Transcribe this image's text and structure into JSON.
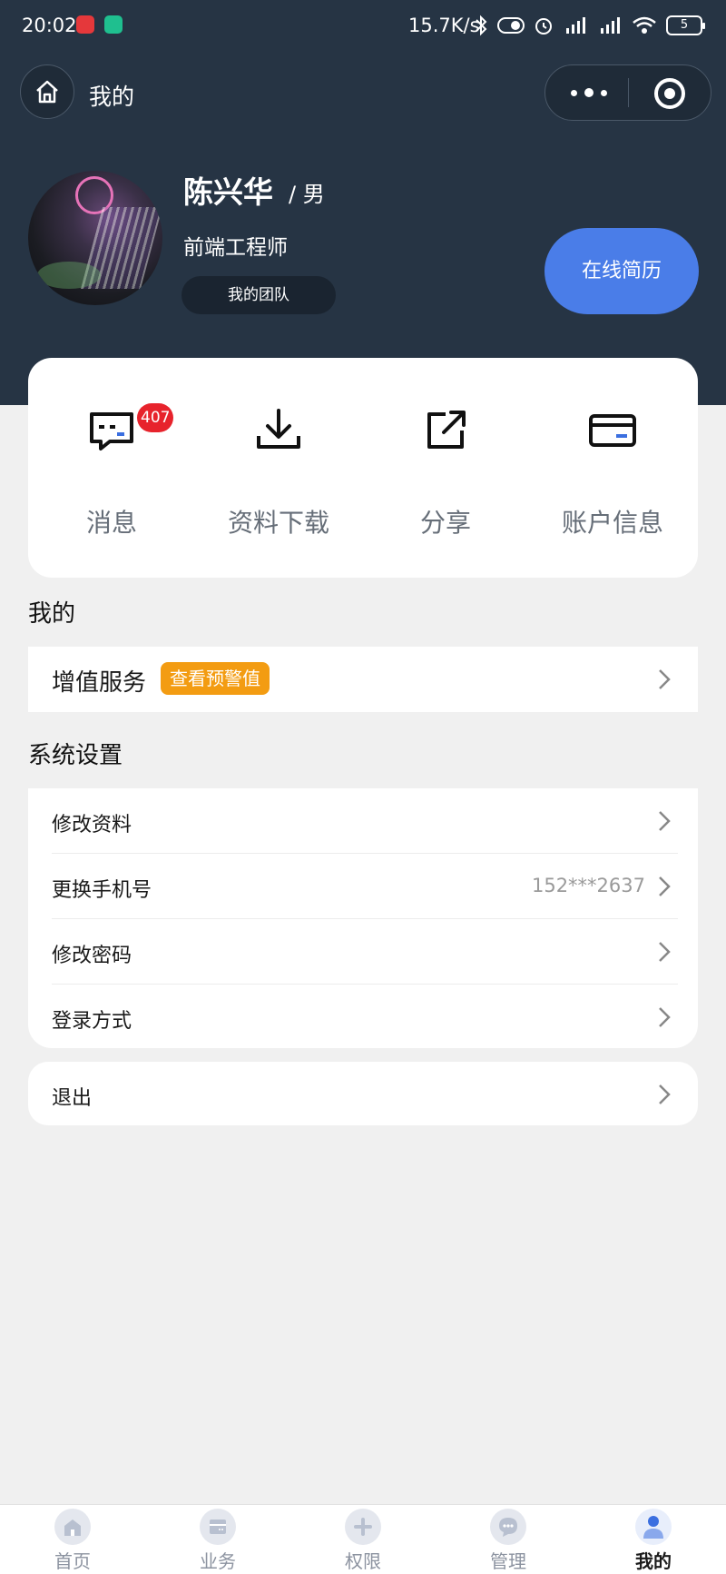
{
  "status_bar": {
    "time": "20:02",
    "network_speed": "15.7K/s",
    "battery": "5"
  },
  "nav": {
    "title": "我的",
    "icons": [
      "home-icon",
      "more-icon",
      "close-target-icon"
    ]
  },
  "profile": {
    "name": "陈兴华",
    "gender": "/ 男",
    "role": "前端工程师",
    "team_button": "我的团队",
    "resume_button": "在线简历"
  },
  "quick_actions": [
    {
      "label": "消息",
      "icon": "message-icon",
      "badge": "407"
    },
    {
      "label": "资料下载",
      "icon": "download-icon"
    },
    {
      "label": "分享",
      "icon": "share-icon"
    },
    {
      "label": "账户信息",
      "icon": "card-icon"
    }
  ],
  "sections": {
    "mine": {
      "title": "我的",
      "items": [
        {
          "label": "增值服务",
          "tag": "查看预警值"
        }
      ]
    },
    "settings": {
      "title": "系统设置",
      "items": [
        {
          "label": "修改资料",
          "value": ""
        },
        {
          "label": "更换手机号",
          "value": "152***2637"
        },
        {
          "label": "修改密码",
          "value": ""
        },
        {
          "label": "登录方式",
          "value": ""
        }
      ]
    },
    "logout": {
      "label": "退出"
    }
  },
  "tabbar": {
    "tabs": [
      {
        "label": "首页",
        "icon": "home-tab-icon"
      },
      {
        "label": "业务",
        "icon": "business-tab-icon"
      },
      {
        "label": "权限",
        "icon": "permission-tab-icon"
      },
      {
        "label": "管理",
        "icon": "manage-tab-icon"
      },
      {
        "label": "我的",
        "icon": "profile-tab-icon",
        "active": true
      }
    ]
  },
  "colors": {
    "header_bg": "#263444",
    "accent_blue": "#4a7de8",
    "warn_orange": "#f39c12",
    "badge_red": "#e7232c"
  }
}
